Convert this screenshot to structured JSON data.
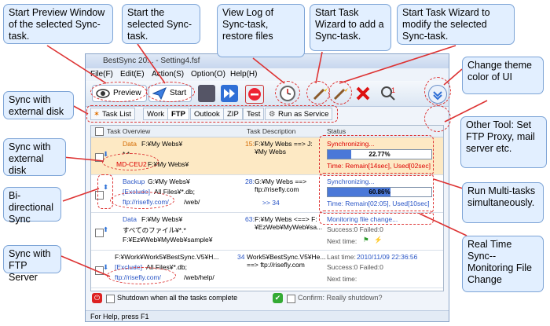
{
  "window": {
    "title": "BestSync 20... - Setting4.fsf",
    "menu": [
      "File(F)",
      "Edit(E)",
      "Action(S)",
      "Option(O)",
      "Help(H)"
    ],
    "toolbar": {
      "preview_label": "Preview",
      "start_label": "Start"
    },
    "tabs": [
      "Task List",
      "Work",
      "FTP",
      "Outlook",
      "ZIP",
      "Test",
      "Run as Service"
    ],
    "active_tab": "FTP",
    "columns": [
      "Task Overview",
      "Task Description",
      "Status"
    ],
    "rows": [
      {
        "line1_type": "Data",
        "line1_path": "F:¥My Webs¥",
        "line2": "* *",
        "line3_a": "MD-CEU2",
        "line3_b": "F:¥My Webs¥",
        "desc_num": "15:",
        "desc_text": "F:¥My Webs ==> J:¥My Webs",
        "status": "Synchronizing...",
        "progress_label": "22.77%",
        "progress": 0.2277,
        "time": "Time: Remain[14sec], Used[02sec]"
      },
      {
        "line1_type": "Backup",
        "line1_path": "G:¥My Webs¥",
        "line2_a": "[Exclude]",
        "line2_b": "All Files¥*.db;",
        "line3_a": "ftp://risefly.com/",
        "line3_b": "/web/",
        "desc_num": "28:",
        "desc_text": "G:¥My Webs ==> ftp://risefly.com",
        "desc_extra": ">> 34",
        "status": "Synchronizing...",
        "progress_label": "60.86%",
        "progress": 0.6086,
        "time": "Time: Remain[02:05], Used[10sec]"
      },
      {
        "line1_type": "Data",
        "line1_path": "F:¥My Webs¥",
        "line2": "すべてのファイル¥*.*",
        "line3": "F:¥Ez¥Web¥MyWeb¥sample¥",
        "desc_num": "63:",
        "desc_text": "F:¥My Webs <==> F:¥EzWeb¥MyWeb¥sa...",
        "status": "Monitoring file change...",
        "success": "Success:0 Failed:0",
        "next": "Next time:"
      },
      {
        "line1": "F:¥Work¥Work5¥BestSync.V5¥H...",
        "line2_a": "[Exclude]",
        "line2_b": "All Files¥*.db;",
        "line3_a": "ftp://risefly.com/",
        "line3_b": "/web/help/",
        "desc_num": "34",
        "desc_text": "Work5¥BestSync.V5¥He... ==> ftp://risefly.com",
        "last": "Last time:",
        "last_val": "2010/11/09 22:36:56",
        "success": "Success:0 Failed:0",
        "next": "Next time:"
      }
    ],
    "shutdown": "Shutdown when all the tasks complete",
    "confirm": "Confirm: Really shutdown?",
    "status_bar": "For Help, press F1"
  },
  "callouts": {
    "preview": "Start Preview Window of the selected Sync-task.",
    "start": "Start the selected Sync-task.",
    "log": "View Log of Sync-task, restore files",
    "wizard_add": "Start Task Wizard to add a Sync-task.",
    "wizard_modify": "Start Task Wizard to modify the selected Sync-task.",
    "theme": "Change theme color  of  UI",
    "ext_disk_1": "Sync with external disk",
    "ext_disk_2": "Sync with external disk",
    "bidir": "Bi-directional Sync",
    "ftp": "Sync with FTP Server",
    "other": "Other Tool: Set FTP Proxy, mail server etc.",
    "multi": "Run Multi-tasks simultaneously.",
    "realtime": "Real Time Sync-- Monitoring File Change"
  },
  "colors": {
    "callout_bg": "#e2efff",
    "highlight": "#dd2222",
    "progress": "#4a78d8"
  }
}
